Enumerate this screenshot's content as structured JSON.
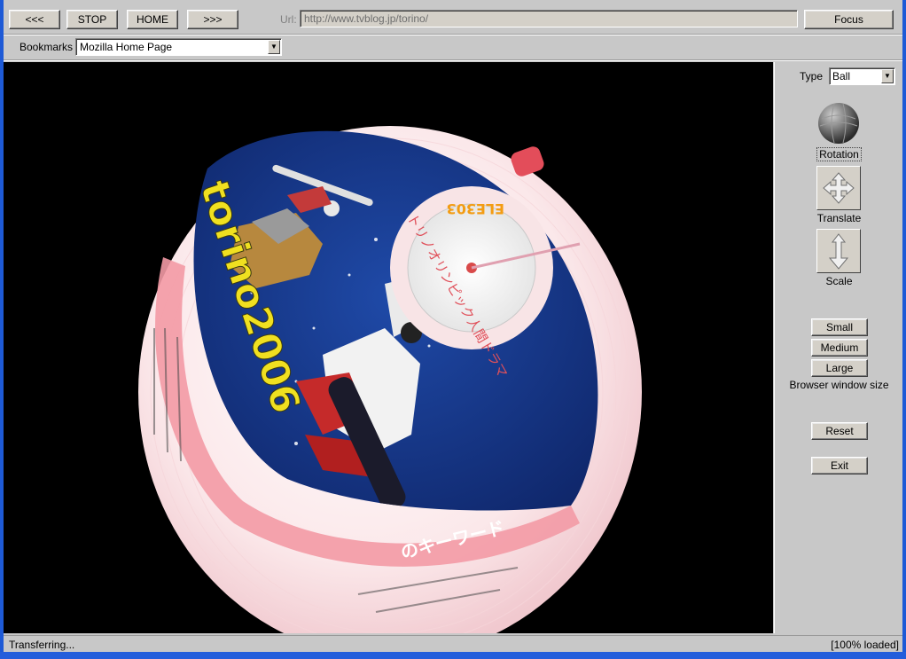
{
  "toolbar": {
    "back_label": "<<<",
    "stop_label": "STOP",
    "home_label": "HOME",
    "forward_label": ">>>",
    "url_label": "Url:",
    "url_value": "http://www.tvblog.jp/torino/",
    "focus_label": "Focus"
  },
  "bookmarks": {
    "label": "Bookmarks",
    "selected": "Mozilla Home Page"
  },
  "side_panel": {
    "type_label": "Type",
    "type_selected": "Ball",
    "rotation_label": "Rotation",
    "translate_label": "Translate",
    "scale_label": "Scale",
    "small_label": "Small",
    "medium_label": "Medium",
    "large_label": "Large",
    "window_size_caption": "Browser window size",
    "reset_label": "Reset",
    "exit_label": "Exit"
  },
  "status": {
    "left": "Transferring...",
    "right": "[100% loaded]"
  },
  "sphere_text": {
    "headline": "torino2006",
    "banner": "のキーワード",
    "gauge_title": "トリノオリンピック人間ドラマ",
    "gauge_logo": "ELE303"
  },
  "colors": {
    "accent_blue": "#1e5ad6",
    "viewport_bg": "#000000",
    "sky_blue": "#1a3a8c",
    "ribbon_pink": "#f4a0a8",
    "headline_yellow": "#f0e020"
  },
  "icons": {
    "rotation": "sphere-icon",
    "translate": "four-arrows-icon",
    "scale": "vertical-arrow-icon"
  }
}
